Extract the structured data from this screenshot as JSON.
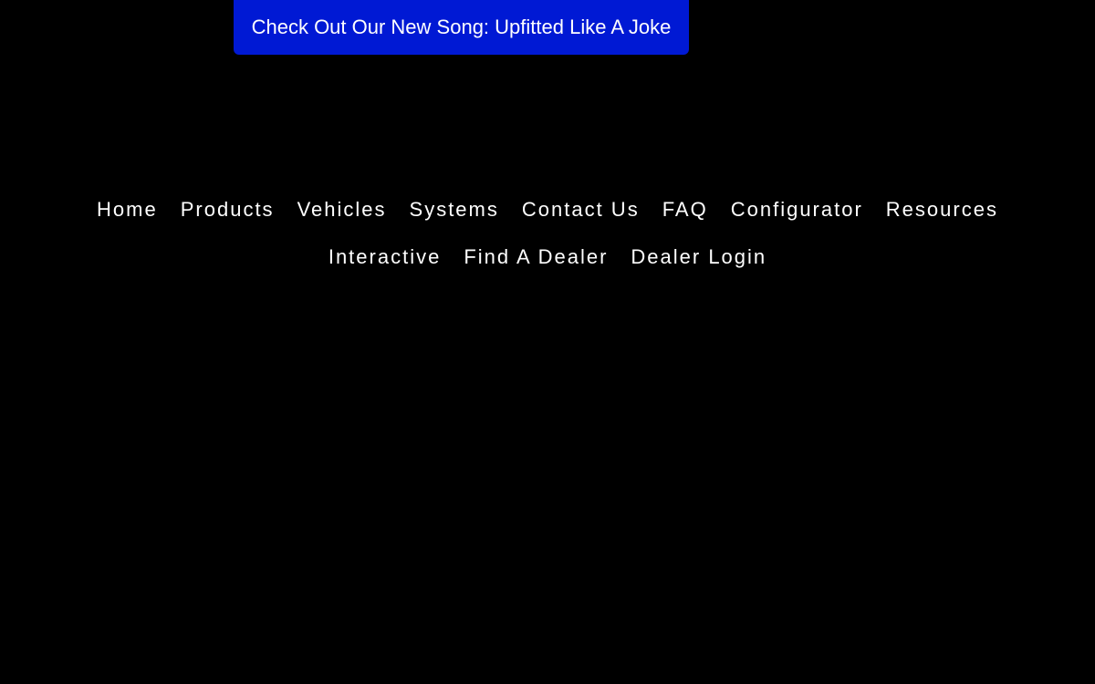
{
  "promo": {
    "label": "Check Out Our New Song: Upfitted Like A Joke",
    "background_color": "#0019d4"
  },
  "nav": {
    "row1": [
      {
        "label": "Home"
      },
      {
        "label": "Products"
      },
      {
        "label": "Vehicles"
      },
      {
        "label": "Systems"
      },
      {
        "label": "Contact Us"
      },
      {
        "label": "FAQ"
      },
      {
        "label": "Configurator"
      },
      {
        "label": "Resources"
      }
    ],
    "row2": [
      {
        "label": "Interactive"
      },
      {
        "label": "Find A Dealer"
      },
      {
        "label": "Dealer Login"
      }
    ]
  },
  "colors": {
    "background": "#000000",
    "text": "#ffffff"
  }
}
